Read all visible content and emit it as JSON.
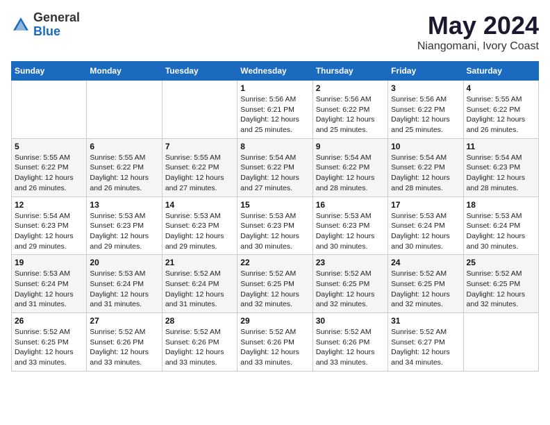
{
  "logo": {
    "general": "General",
    "blue": "Blue"
  },
  "title": {
    "month_year": "May 2024",
    "location": "Niangomani, Ivory Coast"
  },
  "weekdays": [
    "Sunday",
    "Monday",
    "Tuesday",
    "Wednesday",
    "Thursday",
    "Friday",
    "Saturday"
  ],
  "weeks": [
    [
      {
        "day": "",
        "sunrise": "",
        "sunset": "",
        "daylight": ""
      },
      {
        "day": "",
        "sunrise": "",
        "sunset": "",
        "daylight": ""
      },
      {
        "day": "",
        "sunrise": "",
        "sunset": "",
        "daylight": ""
      },
      {
        "day": "1",
        "sunrise": "Sunrise: 5:56 AM",
        "sunset": "Sunset: 6:21 PM",
        "daylight": "Daylight: 12 hours and 25 minutes."
      },
      {
        "day": "2",
        "sunrise": "Sunrise: 5:56 AM",
        "sunset": "Sunset: 6:22 PM",
        "daylight": "Daylight: 12 hours and 25 minutes."
      },
      {
        "day": "3",
        "sunrise": "Sunrise: 5:56 AM",
        "sunset": "Sunset: 6:22 PM",
        "daylight": "Daylight: 12 hours and 25 minutes."
      },
      {
        "day": "4",
        "sunrise": "Sunrise: 5:55 AM",
        "sunset": "Sunset: 6:22 PM",
        "daylight": "Daylight: 12 hours and 26 minutes."
      }
    ],
    [
      {
        "day": "5",
        "sunrise": "Sunrise: 5:55 AM",
        "sunset": "Sunset: 6:22 PM",
        "daylight": "Daylight: 12 hours and 26 minutes."
      },
      {
        "day": "6",
        "sunrise": "Sunrise: 5:55 AM",
        "sunset": "Sunset: 6:22 PM",
        "daylight": "Daylight: 12 hours and 26 minutes."
      },
      {
        "day": "7",
        "sunrise": "Sunrise: 5:55 AM",
        "sunset": "Sunset: 6:22 PM",
        "daylight": "Daylight: 12 hours and 27 minutes."
      },
      {
        "day": "8",
        "sunrise": "Sunrise: 5:54 AM",
        "sunset": "Sunset: 6:22 PM",
        "daylight": "Daylight: 12 hours and 27 minutes."
      },
      {
        "day": "9",
        "sunrise": "Sunrise: 5:54 AM",
        "sunset": "Sunset: 6:22 PM",
        "daylight": "Daylight: 12 hours and 28 minutes."
      },
      {
        "day": "10",
        "sunrise": "Sunrise: 5:54 AM",
        "sunset": "Sunset: 6:22 PM",
        "daylight": "Daylight: 12 hours and 28 minutes."
      },
      {
        "day": "11",
        "sunrise": "Sunrise: 5:54 AM",
        "sunset": "Sunset: 6:23 PM",
        "daylight": "Daylight: 12 hours and 28 minutes."
      }
    ],
    [
      {
        "day": "12",
        "sunrise": "Sunrise: 5:54 AM",
        "sunset": "Sunset: 6:23 PM",
        "daylight": "Daylight: 12 hours and 29 minutes."
      },
      {
        "day": "13",
        "sunrise": "Sunrise: 5:53 AM",
        "sunset": "Sunset: 6:23 PM",
        "daylight": "Daylight: 12 hours and 29 minutes."
      },
      {
        "day": "14",
        "sunrise": "Sunrise: 5:53 AM",
        "sunset": "Sunset: 6:23 PM",
        "daylight": "Daylight: 12 hours and 29 minutes."
      },
      {
        "day": "15",
        "sunrise": "Sunrise: 5:53 AM",
        "sunset": "Sunset: 6:23 PM",
        "daylight": "Daylight: 12 hours and 30 minutes."
      },
      {
        "day": "16",
        "sunrise": "Sunrise: 5:53 AM",
        "sunset": "Sunset: 6:23 PM",
        "daylight": "Daylight: 12 hours and 30 minutes."
      },
      {
        "day": "17",
        "sunrise": "Sunrise: 5:53 AM",
        "sunset": "Sunset: 6:24 PM",
        "daylight": "Daylight: 12 hours and 30 minutes."
      },
      {
        "day": "18",
        "sunrise": "Sunrise: 5:53 AM",
        "sunset": "Sunset: 6:24 PM",
        "daylight": "Daylight: 12 hours and 30 minutes."
      }
    ],
    [
      {
        "day": "19",
        "sunrise": "Sunrise: 5:53 AM",
        "sunset": "Sunset: 6:24 PM",
        "daylight": "Daylight: 12 hours and 31 minutes."
      },
      {
        "day": "20",
        "sunrise": "Sunrise: 5:53 AM",
        "sunset": "Sunset: 6:24 PM",
        "daylight": "Daylight: 12 hours and 31 minutes."
      },
      {
        "day": "21",
        "sunrise": "Sunrise: 5:52 AM",
        "sunset": "Sunset: 6:24 PM",
        "daylight": "Daylight: 12 hours and 31 minutes."
      },
      {
        "day": "22",
        "sunrise": "Sunrise: 5:52 AM",
        "sunset": "Sunset: 6:25 PM",
        "daylight": "Daylight: 12 hours and 32 minutes."
      },
      {
        "day": "23",
        "sunrise": "Sunrise: 5:52 AM",
        "sunset": "Sunset: 6:25 PM",
        "daylight": "Daylight: 12 hours and 32 minutes."
      },
      {
        "day": "24",
        "sunrise": "Sunrise: 5:52 AM",
        "sunset": "Sunset: 6:25 PM",
        "daylight": "Daylight: 12 hours and 32 minutes."
      },
      {
        "day": "25",
        "sunrise": "Sunrise: 5:52 AM",
        "sunset": "Sunset: 6:25 PM",
        "daylight": "Daylight: 12 hours and 32 minutes."
      }
    ],
    [
      {
        "day": "26",
        "sunrise": "Sunrise: 5:52 AM",
        "sunset": "Sunset: 6:25 PM",
        "daylight": "Daylight: 12 hours and 33 minutes."
      },
      {
        "day": "27",
        "sunrise": "Sunrise: 5:52 AM",
        "sunset": "Sunset: 6:26 PM",
        "daylight": "Daylight: 12 hours and 33 minutes."
      },
      {
        "day": "28",
        "sunrise": "Sunrise: 5:52 AM",
        "sunset": "Sunset: 6:26 PM",
        "daylight": "Daylight: 12 hours and 33 minutes."
      },
      {
        "day": "29",
        "sunrise": "Sunrise: 5:52 AM",
        "sunset": "Sunset: 6:26 PM",
        "daylight": "Daylight: 12 hours and 33 minutes."
      },
      {
        "day": "30",
        "sunrise": "Sunrise: 5:52 AM",
        "sunset": "Sunset: 6:26 PM",
        "daylight": "Daylight: 12 hours and 33 minutes."
      },
      {
        "day": "31",
        "sunrise": "Sunrise: 5:52 AM",
        "sunset": "Sunset: 6:27 PM",
        "daylight": "Daylight: 12 hours and 34 minutes."
      },
      {
        "day": "",
        "sunrise": "",
        "sunset": "",
        "daylight": ""
      }
    ]
  ]
}
